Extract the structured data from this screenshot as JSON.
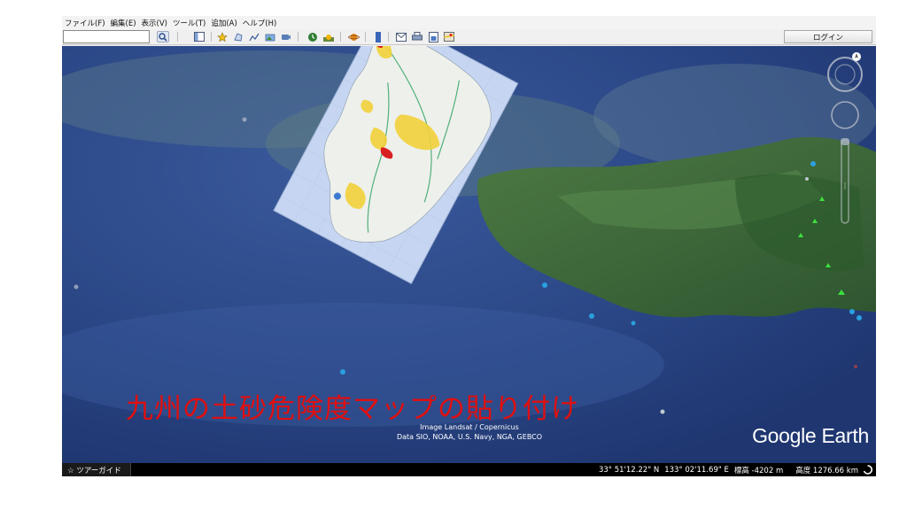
{
  "menu": {
    "items": [
      "ファイル(F)",
      "編集(E)",
      "表示(V)",
      "ツール(T)",
      "追加(A)",
      "ヘルプ(H)"
    ]
  },
  "toolbar": {
    "search_value": "",
    "login_label": "ログイン",
    "icons": [
      "search-icon",
      "sidebar-toggle-icon",
      "placemark-icon",
      "polygon-icon",
      "path-icon",
      "image-overlay-icon",
      "record-tour-icon",
      "historical-imagery-icon",
      "sunlight-icon",
      "planets-icon",
      "ruler-icon",
      "email-icon",
      "print-icon",
      "save-image-icon",
      "google-maps-icon"
    ]
  },
  "map": {
    "caption": "九州の土砂危険度マップの貼り付け",
    "imagery_credit_line1": "Image Landsat / Copernicus",
    "imagery_credit_line2": "Data SIO, NOAA, U.S. Navy, NGA, GEBCO",
    "logo": "Google Earth"
  },
  "statusbar": {
    "tour_guide_label": "☆ ツアーガイド",
    "latitude": "33° 51'12.22\" N",
    "longitude": "133° 02'11.69\" E",
    "elevation": "標高 -4202 m",
    "altitude": "高度 1276.66 km"
  },
  "colors": {
    "ocean": "#2c4a8c",
    "land": "#3f6a3a",
    "caption": "#e01010",
    "hazard_yellow": "#f2d23a",
    "hazard_red": "#d92020"
  }
}
